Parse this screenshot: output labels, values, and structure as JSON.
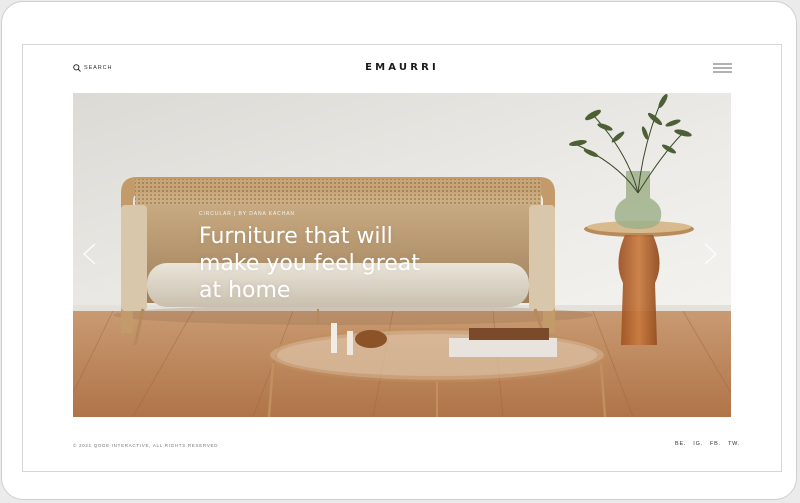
{
  "header": {
    "search_label": "SEARCH",
    "logo": "EMAURRI"
  },
  "hero": {
    "meta": "CIRCULAR | BY DANA KACHAN",
    "title_lines": [
      "Furniture that will",
      "make you feel great",
      "at home"
    ]
  },
  "footer": {
    "copyright": "© 2021 QODE INTERACTIVE, ALL RIGHTS RESERVED",
    "socials": [
      "BE.",
      "IG.",
      "FB.",
      "TW."
    ]
  },
  "icons": {
    "search": "search-icon",
    "menu": "hamburger-menu-icon",
    "prev": "chevron-left-icon",
    "next": "chevron-right-icon"
  },
  "colors": {
    "wall": "#e9e7e3",
    "floor": "#b98158",
    "brass": "#c39a6a",
    "amber_glass": "#b4622a"
  }
}
